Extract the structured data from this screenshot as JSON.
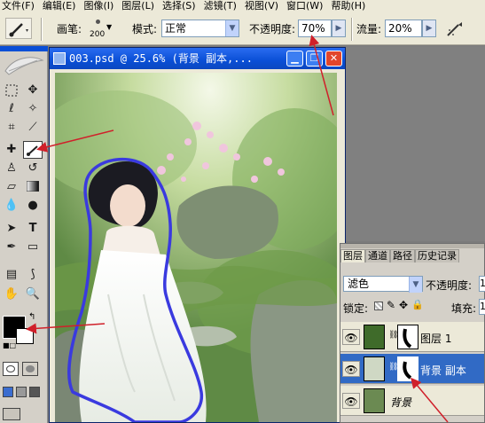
{
  "menu": [
    "文件(F)",
    "编辑(E)",
    "图像(I)",
    "图层(L)",
    "选择(S)",
    "滤镜(T)",
    "视图(V)",
    "窗口(W)",
    "帮助(H)"
  ],
  "options": {
    "brush_label": "画笔:",
    "brush_size": "200",
    "mode_label": "模式:",
    "mode_value": "正常",
    "opacity_label": "不透明度:",
    "opacity_value": "70%",
    "flow_label": "流量:",
    "flow_value": "20%"
  },
  "document": {
    "title": "003.psd @ 25.6% (背景 副本,..."
  },
  "layers_panel": {
    "tabs": [
      "图层",
      "通道",
      "路径",
      "历史记录"
    ],
    "blend_mode": "滤色",
    "opacity_label": "不透明度:",
    "opacity_value": "1",
    "lock_label": "锁定:",
    "fill_label": "填充:",
    "fill_value": "1",
    "layers": [
      {
        "name": "图层 1",
        "selected": false
      },
      {
        "name": "背景 副本",
        "selected": true
      },
      {
        "name": "背景",
        "selected": false
      }
    ]
  },
  "colors": {
    "foreground": "#000000",
    "background": "#ffffff",
    "annotation_arrow": "#d0202a",
    "mask_outline": "#3a3adf",
    "selection": "#316ac5"
  }
}
